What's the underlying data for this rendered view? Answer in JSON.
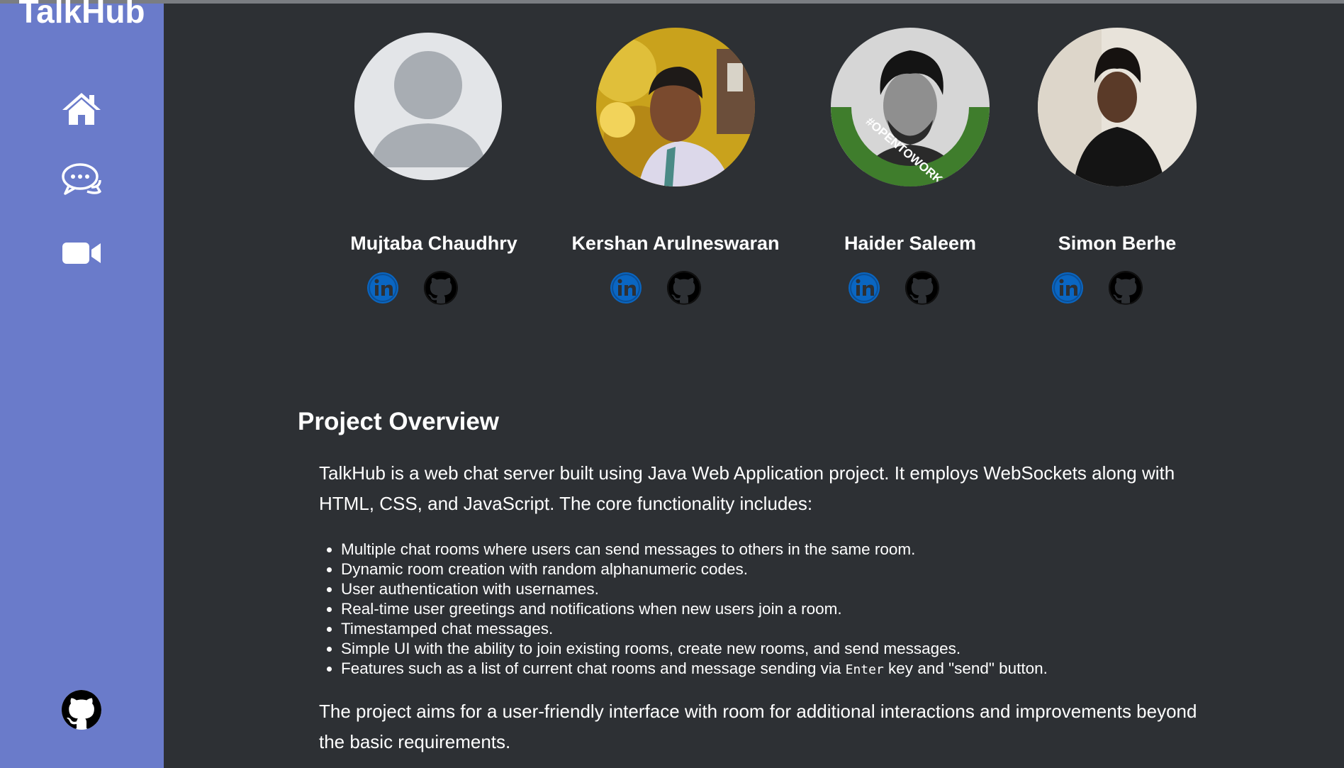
{
  "app": {
    "title": "TalkHub"
  },
  "sidebar": {
    "items": [
      {
        "name": "home",
        "icon": "home-icon"
      },
      {
        "name": "chat",
        "icon": "chat-bubbles-icon"
      },
      {
        "name": "video",
        "icon": "video-camera-icon"
      }
    ],
    "footer_icon": "github-icon"
  },
  "team": [
    {
      "name": "Mujtaba Chaudhry",
      "avatar": "default-avatar",
      "links": [
        "linkedin-icon",
        "github-icon"
      ]
    },
    {
      "name": "Kershan Arulneswaran",
      "avatar": "photo",
      "links": [
        "linkedin-icon",
        "github-icon"
      ]
    },
    {
      "name": "Haider Saleem",
      "avatar": "photo",
      "badge_text": "#OPENTOWORK",
      "links": [
        "linkedin-icon",
        "github-icon"
      ]
    },
    {
      "name": "Simon Berhe",
      "avatar": "photo",
      "links": [
        "linkedin-icon",
        "github-icon"
      ]
    }
  ],
  "overview": {
    "title": "Project Overview",
    "intro": "TalkHub is a web chat server built using Java Web Application project. It employs WebSockets along with HTML, CSS, and JavaScript. The core functionality includes:",
    "features": [
      "Multiple chat rooms where users can send messages to others in the same room.",
      "Dynamic room creation with random alphanumeric codes.",
      "User authentication with usernames.",
      "Real-time user greetings and notifications when new users join a room.",
      "Timestamped chat messages.",
      "Simple UI with the ability to join existing rooms, create new rooms, and send messages."
    ],
    "last_feature": {
      "before": "Features such as a list of current chat rooms and message sending via ",
      "code": "Enter",
      "after": " key and \"send\" button."
    },
    "closing": "The project aims for a user-friendly interface with room for additional interactions and improvements beyond the basic requirements."
  },
  "colors": {
    "sidebar": "#6a7bca",
    "background": "#2d3034",
    "linkedin": "#0a66c2",
    "opentowork_green": "#3f7d2c"
  }
}
